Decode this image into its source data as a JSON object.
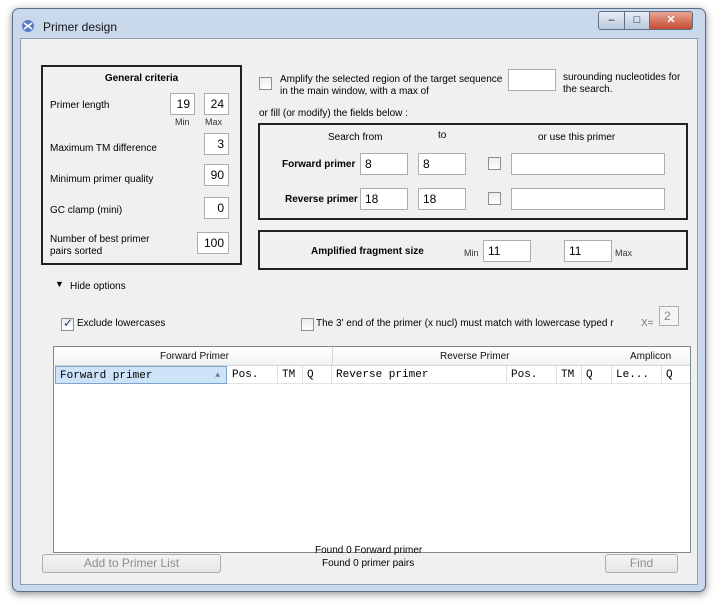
{
  "window": {
    "title": "Primer design",
    "controls": {
      "min": "‒",
      "max": "□",
      "close": "✕"
    }
  },
  "general": {
    "heading": "General criteria",
    "primer_length_label": "Primer length",
    "primer_length_min": "19",
    "primer_length_max": "24",
    "min_label": "Min",
    "max_label": "Max",
    "max_tm_label": "Maximum TM difference",
    "max_tm_value": "3",
    "min_quality_label": "Minimum primer quality",
    "min_quality_value": "90",
    "gc_clamp_label": "GC clamp (mini)",
    "gc_clamp_value": "0",
    "best_pairs_label": "Number of best primer pairs sorted",
    "best_pairs_value": "100"
  },
  "amplify": {
    "label": "Amplify the selected region of the target sequence in the main window, with a max of",
    "value": "",
    "suffix": "surounding nucleotides for the search.",
    "or_fill": "or fill (or modify) the fields below :"
  },
  "search": {
    "from_label": "Search from",
    "to_label": "to",
    "use_label": "or use this primer",
    "forward_label": "Forward primer",
    "forward_from": "8",
    "forward_to": "8",
    "forward_primer": "",
    "reverse_label": "Reverse primer",
    "reverse_from": "18",
    "reverse_to": "18",
    "reverse_primer": ""
  },
  "fragment": {
    "label": "Amplified fragment size",
    "min_label": "Min",
    "min_value": "11",
    "max_value": "11",
    "max_label": "Max"
  },
  "options": {
    "toggle_label": "Hide options",
    "exclude_lowercase": "Exclude lowercases",
    "three_prime_label": "The 3' end of the primer (x nucl) must match with lowercase typed r",
    "x_label": "X=",
    "x_value": "2"
  },
  "table": {
    "groups": [
      "Forward Primer",
      "Reverse Primer",
      "Amplicon"
    ],
    "columns": [
      "Forward primer",
      "Pos.",
      "TM",
      "Q",
      "Reverse primer",
      "Pos.",
      "TM",
      "Q",
      "Le...",
      "Q"
    ]
  },
  "footer": {
    "add_button": "Add to Primer List",
    "found_forward": "Found 0 Forward primer",
    "found_pairs": "Found 0  primer pairs",
    "find_button": "Find"
  },
  "colors": {
    "frame": "#c9d9eb",
    "close": "#c44b32",
    "selection": "#cde3f7"
  }
}
